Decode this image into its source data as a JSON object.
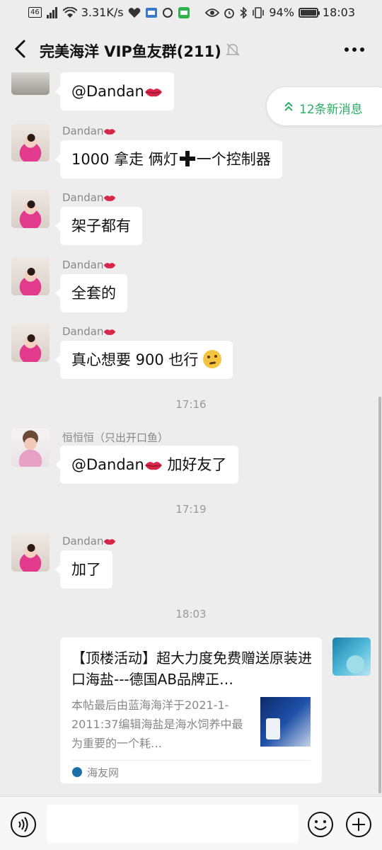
{
  "status_bar": {
    "network": "46",
    "speed": "3.31K/s",
    "battery": "94%",
    "time": "18:03"
  },
  "header": {
    "title": "完美海洋 VIP鱼友群(211)"
  },
  "new_messages_pill": "12条新消息",
  "messages": [
    {
      "sender": "",
      "text": "@Dandan"
    },
    {
      "sender": "Dandan",
      "text": "1000 拿走 俩灯",
      "text_after": "一个控制器"
    },
    {
      "sender": "Dandan",
      "text": "架子都有"
    },
    {
      "sender": "Dandan",
      "text": "全套的"
    },
    {
      "sender": "Dandan",
      "text": "真心想要 900 也行"
    },
    {
      "sender": "恒恒恒（只出开口鱼）",
      "text": "@Dandan",
      "text_after": "加好友了"
    },
    {
      "sender": "Dandan",
      "text": "加了"
    }
  ],
  "timestamps": [
    "17:16",
    "17:19",
    "18:03"
  ],
  "link_card": {
    "title": "【顶楼活动】超大力度免费赠送原装进口海盐---德国AB品牌正…",
    "description": "本帖最后由蓝海海洋于2021-1-2011:37编辑海盐是海水饲养中最为重要的一个耗…",
    "source": "海友网"
  },
  "icons": {
    "back": "chevron-left-icon",
    "mute": "bell-off-icon",
    "more": "more-dots-icon",
    "voice": "voice-icon",
    "emoji": "emoji-icon",
    "plus": "plus-icon",
    "lips": "kiss-lips-icon",
    "thinking": "thinking-face-icon"
  },
  "colors": {
    "accent_green": "#2aae67",
    "background": "#ededed",
    "bubble": "#ffffff"
  }
}
